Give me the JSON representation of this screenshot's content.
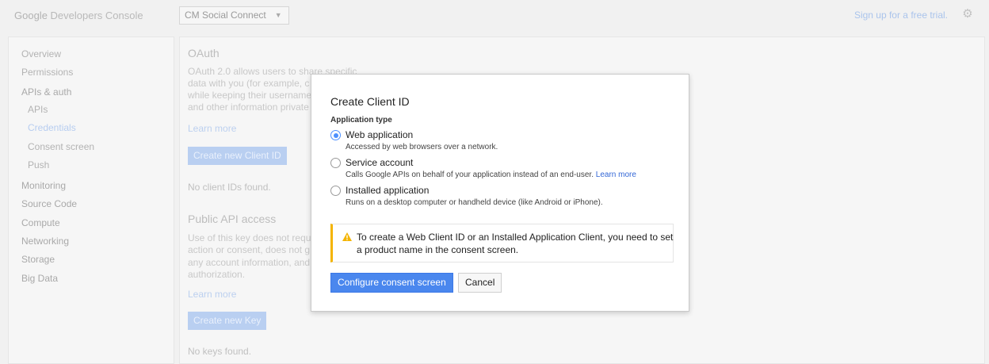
{
  "header": {
    "brand_google": "Google",
    "brand_product": "Developers Console",
    "project": "CM Social Connect",
    "trial_link": "Sign up for a free trial.",
    "settings_icon": "gear-icon"
  },
  "sidebar": {
    "items": [
      {
        "label": "Overview"
      },
      {
        "label": "Permissions"
      },
      {
        "label": "APIs & auth"
      },
      {
        "label": "APIs"
      },
      {
        "label": "Credentials"
      },
      {
        "label": "Consent screen"
      },
      {
        "label": "Push"
      },
      {
        "label": "Monitoring"
      },
      {
        "label": "Source Code"
      },
      {
        "label": "Compute"
      },
      {
        "label": "Networking"
      },
      {
        "label": "Storage"
      },
      {
        "label": "Big Data"
      }
    ]
  },
  "main": {
    "oauth": {
      "title": "OAuth",
      "desc_lines": [
        "OAuth 2.0 allows users to share specific",
        "data with you (for example, c",
        "while keeping their username",
        "and other information private"
      ],
      "learn_more": "Learn more",
      "create_button": "Create new Client ID",
      "empty": "No client IDs found."
    },
    "public_api": {
      "title": "Public API access",
      "desc_lines": [
        "Use of this key does not requ",
        "action or consent, does not g",
        "any account information, and",
        "authorization."
      ],
      "learn_more": "Learn more",
      "create_button": "Create new Key",
      "empty": "No keys found."
    }
  },
  "dialog": {
    "title": "Create Client ID",
    "section_label": "Application type",
    "options": [
      {
        "label": "Web application",
        "desc": "Accessed by web browsers over a network.",
        "selected": true
      },
      {
        "label": "Service account",
        "desc": "Calls Google APIs on behalf of your application instead of an end-user.",
        "desc_link": "Learn more",
        "selected": false
      },
      {
        "label": "Installed application",
        "desc": "Runs on a desktop computer or handheld device (like Android or iPhone).",
        "selected": false
      }
    ],
    "warning": {
      "icon": "warning-icon",
      "text": "To create a Web Client ID or an Installed Application Client, you need to set a product name in the consent screen.",
      "color": "#f4b400"
    },
    "primary_button": "Configure consent screen",
    "secondary_button": "Cancel",
    "accent_color": "#4a87ee"
  }
}
